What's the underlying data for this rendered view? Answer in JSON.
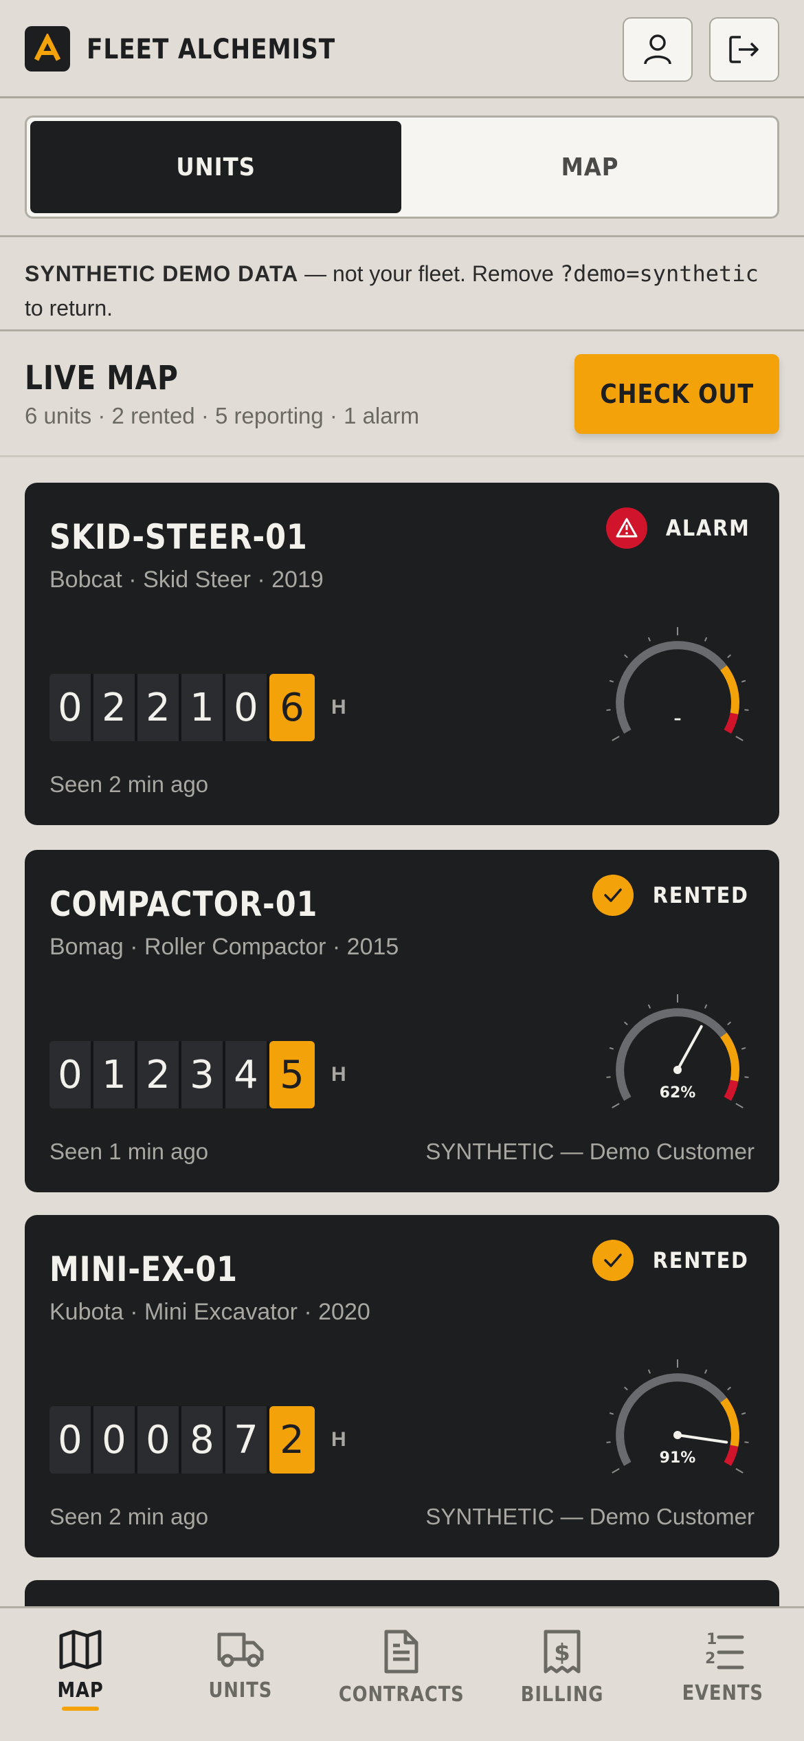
{
  "header": {
    "app_title": "FLEET ALCHEMIST",
    "logo_letter": "A",
    "profile_icon": "user-icon",
    "logout_icon": "logout-icon"
  },
  "tabs": [
    {
      "label": "UNITS",
      "active": true
    },
    {
      "label": "MAP",
      "active": false
    }
  ],
  "banner": {
    "bold": "SYNTHETIC DEMO DATA",
    "text": " — not your fleet. Remove ",
    "code": "?demo=synthetic",
    "tail": "to return."
  },
  "live_map": {
    "title": "LIVE MAP",
    "summary": "6 units · 2 rented · 5 reporting · 1 alarm",
    "checkout_label": "CHECK OUT"
  },
  "units": [
    {
      "name": "SKID-STEER-01",
      "meta": "Bobcat · Skid Steer · 2019",
      "status": "ALARM",
      "status_icon": "warning-icon",
      "status_color": "#d0142c",
      "digits": [
        "0",
        "2",
        "2",
        "1",
        "0",
        "6"
      ],
      "hours_unit": "H",
      "gauge_label": "–",
      "gauge_percent": null,
      "seen": "Seen 2 min ago",
      "customer": ""
    },
    {
      "name": "COMPACTOR-01",
      "meta": "Bomag · Roller Compactor · 2015",
      "status": "RENTED",
      "status_icon": "check-icon",
      "status_color": "#f4a20a",
      "digits": [
        "0",
        "1",
        "2",
        "3",
        "4",
        "5"
      ],
      "hours_unit": "H",
      "gauge_label": "62%",
      "gauge_percent": 62,
      "seen": "Seen 1 min ago",
      "customer": "SYNTHETIC — Demo Customer"
    },
    {
      "name": "MINI-EX-01",
      "meta": "Kubota · Mini Excavator · 2020",
      "status": "RENTED",
      "status_icon": "check-icon",
      "status_color": "#f4a20a",
      "digits": [
        "0",
        "0",
        "0",
        "8",
        "7",
        "2"
      ],
      "hours_unit": "H",
      "gauge_label": "91%",
      "gauge_percent": 91,
      "seen": "Seen 2 min ago",
      "customer": "SYNTHETIC — Demo Customer"
    }
  ],
  "bottom_nav": [
    {
      "label": "MAP",
      "icon": "map-icon",
      "active": true
    },
    {
      "label": "UNITS",
      "icon": "truck-icon",
      "active": false
    },
    {
      "label": "CONTRACTS",
      "icon": "document-icon",
      "active": false
    },
    {
      "label": "BILLING",
      "icon": "receipt-dollar-icon",
      "active": false
    },
    {
      "label": "EVENTS",
      "icon": "numbered-list-icon",
      "active": false
    }
  ],
  "colors": {
    "accent": "#f4a20a",
    "alarm": "#d0142c",
    "dark": "#1d1e20",
    "background": "#e1ddd6"
  }
}
